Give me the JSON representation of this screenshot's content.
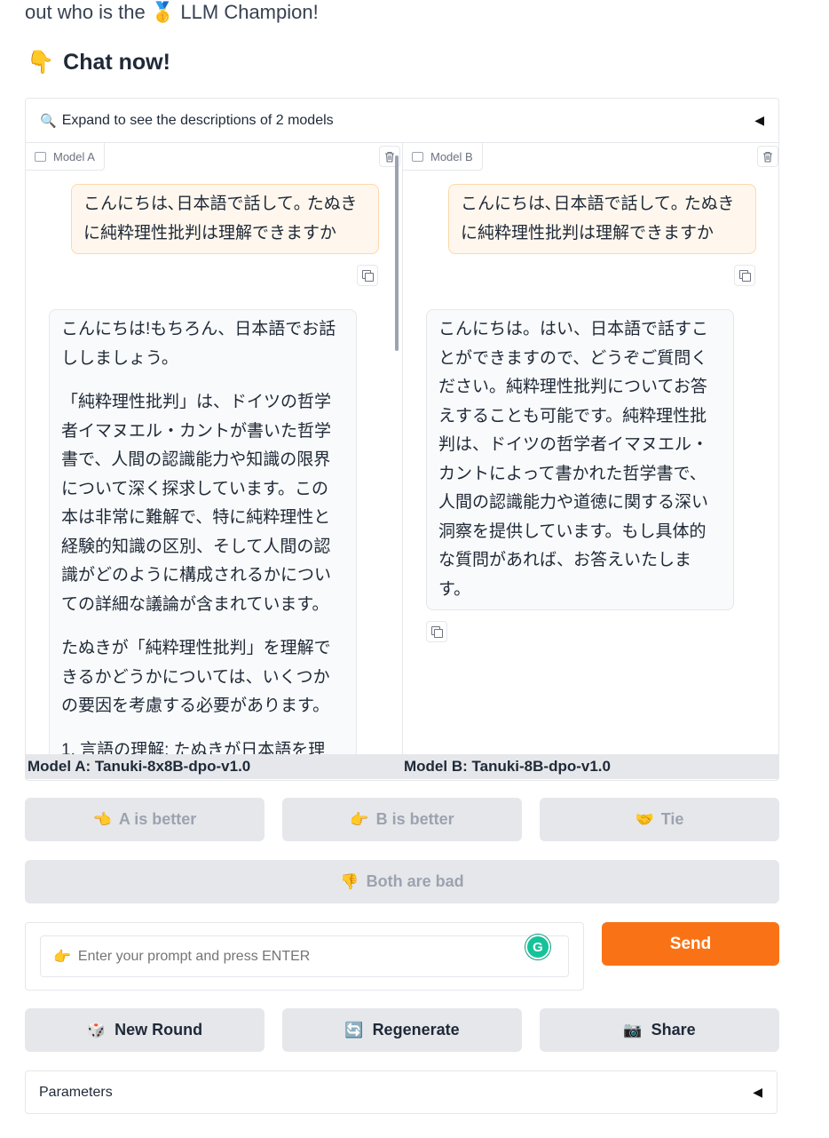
{
  "intro": {
    "text_prefix": "out who is the",
    "medal": "🥇",
    "text_suffix": "LLM Champion!"
  },
  "chat_now": {
    "emoji": "👇",
    "label": "Chat now!"
  },
  "accordion": {
    "icon": "🔍",
    "label": "Expand to see the descriptions of 2 models",
    "arrow": "◀"
  },
  "chat_a": {
    "label": "Model A",
    "user_message": "こんにちは､日本語で話して｡ たぬきに純粋理性批判は理解できますか",
    "bot_paragraphs": [
      "こんにちは!もちろん、日本語でお話ししましょう。",
      "「純粋理性批判」は、ドイツの哲学者イマヌエル・カントが書いた哲学書で、人間の認識能力や知識の限界について深く探求しています。この本は非常に難解で、特に純粋理性と経験的知識の区別、そして人間の認識がどのように構成されるかについての詳細な議論が含まれています。",
      "たぬきが「純粋理性批判」を理解できるかどうかについては、いくつかの要因を考慮する必要があります。",
      "1. 言語の理解: たぬきが日本語を理"
    ]
  },
  "chat_b": {
    "label": "Model B",
    "user_message": "こんにちは､日本語で話して｡ たぬきに純粋理性批判は理解できますか",
    "bot_paragraphs": [
      "こんにちは。はい、日本語で話すことができますので、どうぞご質問ください。純粋理性批判についてお答えすることも可能です。純粋理性批判は、ドイツの哲学者イマヌエル・カントによって書かれた哲学書で、人間の認識能力や道徳に関する深い洞察を提供しています。もし具体的な質問があれば、お答えいたします。"
    ]
  },
  "model_names": {
    "a": "Model A: Tanuki-8x8B-dpo-v1.0",
    "b": "Model B: Tanuki-8B-dpo-v1.0"
  },
  "vote": {
    "a_better": {
      "emoji": "👈",
      "label": "A is better"
    },
    "b_better": {
      "emoji": "👉",
      "label": "B is better"
    },
    "tie": {
      "emoji": "🤝",
      "label": "Tie"
    },
    "both_bad": {
      "emoji": "👎",
      "label": "Both are bad"
    }
  },
  "input": {
    "emoji": "👉",
    "placeholder": "Enter your prompt and press ENTER",
    "value": ""
  },
  "send_label": "Send",
  "actions": {
    "new_round": {
      "emoji": "🎲",
      "label": "New Round"
    },
    "regenerate": {
      "emoji": "🔄",
      "label": "Regenerate"
    },
    "share": {
      "emoji": "📷",
      "label": "Share"
    }
  },
  "parameters": {
    "label": "Parameters",
    "arrow": "◀"
  },
  "colors": {
    "accent": "#f97316",
    "user_bubble": "#fff7ed",
    "button_bg": "#e5e7eb"
  }
}
